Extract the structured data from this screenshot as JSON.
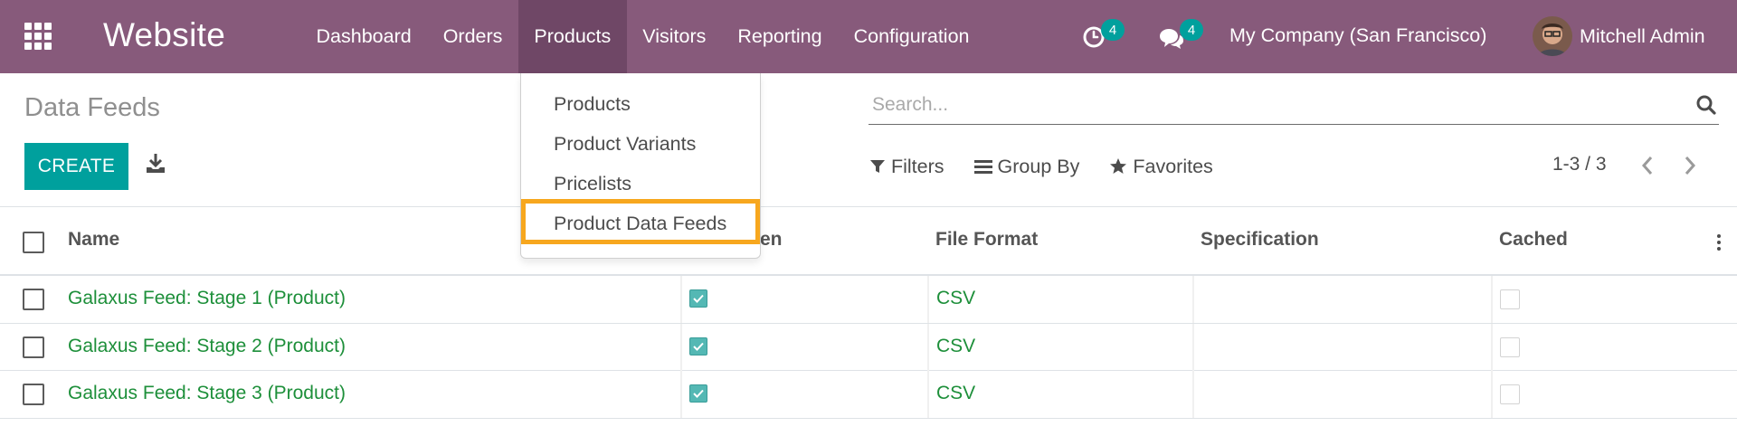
{
  "navbar": {
    "brand": "Website",
    "menu": [
      "Dashboard",
      "Orders",
      "Products",
      "Visitors",
      "Reporting",
      "Configuration"
    ],
    "active_menu": "Products",
    "activity_count": "4",
    "messages_count": "4",
    "company": "My Company (San Francisco)",
    "user": "Mitchell Admin"
  },
  "control_panel": {
    "breadcrumb": "Data Feeds",
    "create_label": "CREATE",
    "search_placeholder": "Search...",
    "filters_label": "Filters",
    "group_by_label": "Group By",
    "favorites_label": "Favorites",
    "pager": "1-3 / 3"
  },
  "dropdown": {
    "items": [
      "Products",
      "Product Variants",
      "Pricelists",
      "Product Data Feeds"
    ],
    "highlighted": "Product Data Feeds"
  },
  "list": {
    "columns": {
      "name": "Name",
      "hidden_partial": "en",
      "file_format": "File Format",
      "specification": "Specification",
      "cached": "Cached"
    },
    "rows": [
      {
        "name": "Galaxus Feed: Stage 1 (Product)",
        "checked": true,
        "file_format": "CSV",
        "specification": "",
        "cached": false
      },
      {
        "name": "Galaxus Feed: Stage 2 (Product)",
        "checked": true,
        "file_format": "CSV",
        "specification": "",
        "cached": false
      },
      {
        "name": "Galaxus Feed: Stage 3 (Product)",
        "checked": true,
        "file_format": "CSV",
        "specification": "",
        "cached": false
      }
    ]
  },
  "colors": {
    "navbar": "#875a7b",
    "navbar_active": "#6f4766",
    "primary": "#00a09d",
    "link_green": "#1d8f3a",
    "highlight": "#f7a71e"
  }
}
